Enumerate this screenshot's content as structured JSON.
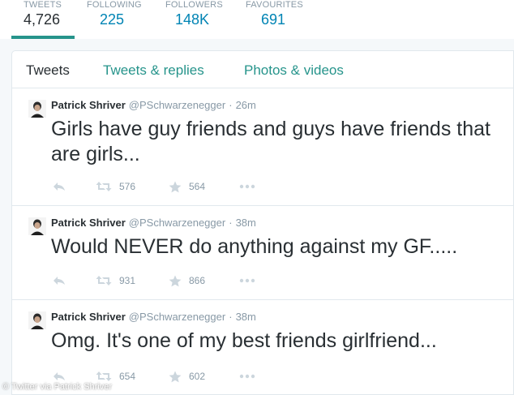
{
  "profile_nav": [
    {
      "label": "TWEETS",
      "value": "4,726",
      "active": true
    },
    {
      "label": "FOLLOWING",
      "value": "225"
    },
    {
      "label": "FOLLOWERS",
      "value": "148K"
    },
    {
      "label": "FAVOURITES",
      "value": "691"
    }
  ],
  "tabs": [
    "Tweets",
    "Tweets & replies",
    "Photos & videos"
  ],
  "tweets": [
    {
      "name": "Patrick Shriver",
      "handle": "@PSchwarzenegger",
      "separator": "·",
      "time": "26m",
      "text": "Girls have guy friends and guys have friends that are girls...",
      "retweets": "576",
      "favorites": "564"
    },
    {
      "name": "Patrick Shriver",
      "handle": "@PSchwarzenegger",
      "separator": "·",
      "time": "38m",
      "text": "Would NEVER do anything against my GF.....",
      "retweets": "931",
      "favorites": "866"
    },
    {
      "name": "Patrick Shriver",
      "handle": "@PSchwarzenegger",
      "separator": "·",
      "time": "38m",
      "text": "Omg. It's one of my best friends girlfriend...",
      "retweets": "654",
      "favorites": "602"
    }
  ],
  "icons": {
    "reply": "reply-icon",
    "retweet": "retweet-icon",
    "favorite": "star-icon",
    "more": "more-icon"
  },
  "colors": {
    "accent": "#26948b",
    "link": "#0084b4",
    "muted": "#8899a6"
  },
  "watermark": "© Twitter via Patrick Shriver"
}
